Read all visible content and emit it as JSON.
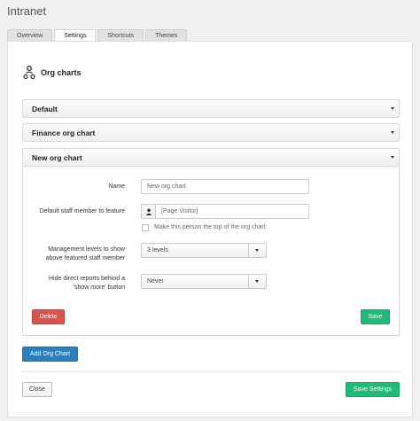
{
  "app": {
    "title": "Intranet"
  },
  "tabs": [
    {
      "label": "Overview",
      "active": false
    },
    {
      "label": "Settings",
      "active": true
    },
    {
      "label": "Shortcuts",
      "active": false
    },
    {
      "label": "Themes",
      "active": false
    }
  ],
  "section": {
    "title": "Org charts",
    "icon": "org-chart-icon"
  },
  "accordions": [
    {
      "title": "Default",
      "expanded": false
    },
    {
      "title": "Finance org chart",
      "expanded": false
    },
    {
      "title": "New org chart",
      "expanded": true
    }
  ],
  "form": {
    "name_label": "Name",
    "name_value": "New org chart",
    "staff_label": "Default staff member to feature",
    "staff_value": "[Page Visitor]",
    "top_checkbox_label": "Make this person the top of the org chart",
    "top_checkbox_checked": false,
    "levels_label": "Management levels to show above featured staff member",
    "levels_value": "3 levels",
    "hide_label": "Hide direct reports behind a 'show more' button",
    "hide_value": "Never",
    "delete_label": "Delete",
    "save_label": "Save"
  },
  "actions": {
    "add_label": "Add Org Chart",
    "close_label": "Close",
    "save_settings_label": "Save Settings"
  },
  "colors": {
    "danger": "#d9534f",
    "success": "#1fba75",
    "primary": "#2a7fc1"
  }
}
